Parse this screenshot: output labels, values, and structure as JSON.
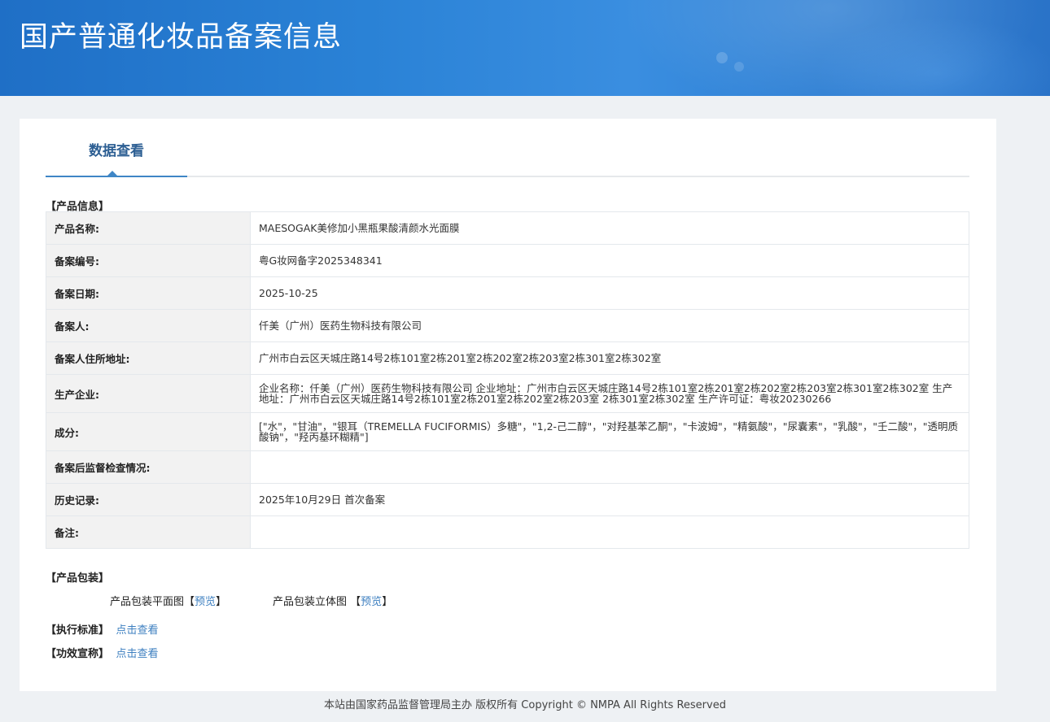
{
  "header": {
    "title": "国产普通化妆品备案信息"
  },
  "tab": {
    "label": "数据查看"
  },
  "sections": {
    "product_info": "【产品信息】",
    "packaging": "【产品包装】",
    "standard": "【执行标准】",
    "efficacy": "【功效宣称】"
  },
  "table": {
    "rows": [
      {
        "label": "产品名称:",
        "value": "MAESOGAK美修加小黑瓶果酸清颜水光面膜"
      },
      {
        "label": "备案编号:",
        "value": "粤G妆网备字2025348341"
      },
      {
        "label": "备案日期:",
        "value": "2025-10-25"
      },
      {
        "label": "备案人:",
        "value": "仟美（广州）医药生物科技有限公司"
      },
      {
        "label": "备案人住所地址:",
        "value": "广州市白云区天城庄路14号2栋101室2栋201室2栋202室2栋203室2栋301室2栋302室"
      },
      {
        "label": "生产企业:",
        "value": "企业名称：仟美（广州）医药生物科技有限公司 企业地址：广州市白云区天城庄路14号2栋101室2栋201室2栋202室2栋203室2栋301室2栋302室 生产地址：广州市白云区天城庄路14号2栋101室2栋201室2栋202室2栋203室 2栋301室2栋302室 生产许可证：粤妆20230266"
      },
      {
        "label": "成分:",
        "value": "[\"水\"，\"甘油\"，\"银耳（TREMELLA FUCIFORMIS）多糖\"，\"1,2-己二醇\"，\"对羟基苯乙酮\"，\"卡波姆\"，\"精氨酸\"，\"尿囊素\"，\"乳酸\"，\"壬二酸\"，\"透明质酸钠\"，\"羟丙基环糊精\"]"
      },
      {
        "label": "备案后监督检查情况:",
        "value": ""
      },
      {
        "label": "历史记录:",
        "value": "2025年10月29日 首次备案"
      },
      {
        "label": "备注:",
        "value": ""
      }
    ]
  },
  "packaging": {
    "flat_label": "产品包装平面图",
    "stereo_label": "产品包装立体图",
    "bracket_open": "【",
    "bracket_close": "】",
    "preview": "预览"
  },
  "links": {
    "view": "点击查看"
  },
  "footer": {
    "text": "本站由国家药品监督管理局主办 版权所有 Copyright © NMPA All Rights Reserved"
  }
}
